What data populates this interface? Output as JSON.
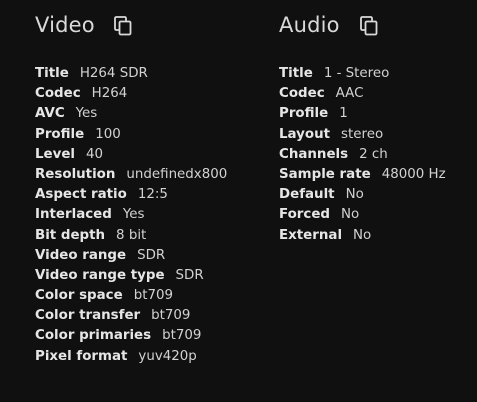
{
  "video": {
    "title": "Video",
    "copy_icon": "copy-icon",
    "rows": [
      {
        "key": "Title",
        "value": "H264 SDR"
      },
      {
        "key": "Codec",
        "value": "H264"
      },
      {
        "key": "AVC",
        "value": "Yes"
      },
      {
        "key": "Profile",
        "value": "100"
      },
      {
        "key": "Level",
        "value": "40"
      },
      {
        "key": "Resolution",
        "value": "undefinedx800"
      },
      {
        "key": "Aspect ratio",
        "value": "12:5"
      },
      {
        "key": "Interlaced",
        "value": "Yes"
      },
      {
        "key": "Bit depth",
        "value": "8 bit"
      },
      {
        "key": "Video range",
        "value": "SDR"
      },
      {
        "key": "Video range type",
        "value": "SDR"
      },
      {
        "key": "Color space",
        "value": "bt709"
      },
      {
        "key": "Color transfer",
        "value": "bt709"
      },
      {
        "key": "Color primaries",
        "value": "bt709"
      },
      {
        "key": "Pixel format",
        "value": "yuv420p"
      }
    ]
  },
  "audio": {
    "title": "Audio",
    "copy_icon": "copy-icon",
    "rows": [
      {
        "key": "Title",
        "value": "1 - Stereo"
      },
      {
        "key": "Codec",
        "value": "AAC"
      },
      {
        "key": "Profile",
        "value": "1"
      },
      {
        "key": "Layout",
        "value": "stereo"
      },
      {
        "key": "Channels",
        "value": "2 ch"
      },
      {
        "key": "Sample rate",
        "value": "48000 Hz"
      },
      {
        "key": "Default",
        "value": "No"
      },
      {
        "key": "Forced",
        "value": "No"
      },
      {
        "key": "External",
        "value": "No"
      }
    ]
  },
  "colors": {
    "background": "#101010",
    "text": "#e6e6e6"
  }
}
